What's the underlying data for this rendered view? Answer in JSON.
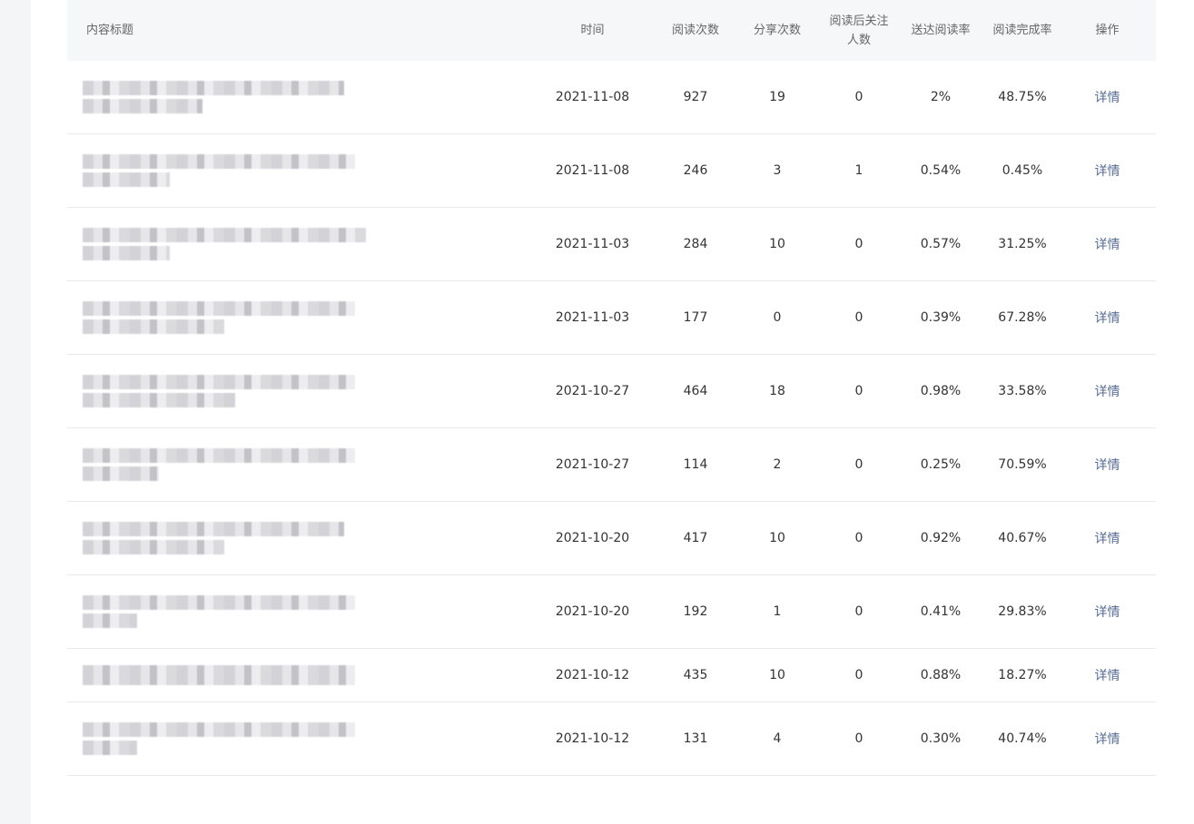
{
  "table": {
    "headers": {
      "title": "内容标题",
      "time": "时间",
      "reads": "阅读次数",
      "shares": "分享次数",
      "follow_line1": "阅读后关注",
      "follow_line2": "人数",
      "reach_rate": "送达阅读率",
      "completion_rate": "阅读完成率",
      "action": "操作"
    },
    "rows": [
      {
        "time": "2021-11-08",
        "reads": "927",
        "shares": "19",
        "follow": "0",
        "reach": "2%",
        "completion": "48.75%",
        "action": "详情"
      },
      {
        "time": "2021-11-08",
        "reads": "246",
        "shares": "3",
        "follow": "1",
        "reach": "0.54%",
        "completion": "0.45%",
        "action": "详情"
      },
      {
        "time": "2021-11-03",
        "reads": "284",
        "shares": "10",
        "follow": "0",
        "reach": "0.57%",
        "completion": "31.25%",
        "action": "详情"
      },
      {
        "time": "2021-11-03",
        "reads": "177",
        "shares": "0",
        "follow": "0",
        "reach": "0.39%",
        "completion": "67.28%",
        "action": "详情"
      },
      {
        "time": "2021-10-27",
        "reads": "464",
        "shares": "18",
        "follow": "0",
        "reach": "0.98%",
        "completion": "33.58%",
        "action": "详情"
      },
      {
        "time": "2021-10-27",
        "reads": "114",
        "shares": "2",
        "follow": "0",
        "reach": "0.25%",
        "completion": "70.59%",
        "action": "详情"
      },
      {
        "time": "2021-10-20",
        "reads": "417",
        "shares": "10",
        "follow": "0",
        "reach": "0.92%",
        "completion": "40.67%",
        "action": "详情"
      },
      {
        "time": "2021-10-20",
        "reads": "192",
        "shares": "1",
        "follow": "0",
        "reach": "0.41%",
        "completion": "29.83%",
        "action": "详情"
      },
      {
        "time": "2021-10-12",
        "reads": "435",
        "shares": "10",
        "follow": "0",
        "reach": "0.88%",
        "completion": "18.27%",
        "action": "详情"
      },
      {
        "time": "2021-10-12",
        "reads": "131",
        "shares": "4",
        "follow": "0",
        "reach": "0.30%",
        "completion": "40.74%",
        "action": "详情"
      }
    ]
  }
}
